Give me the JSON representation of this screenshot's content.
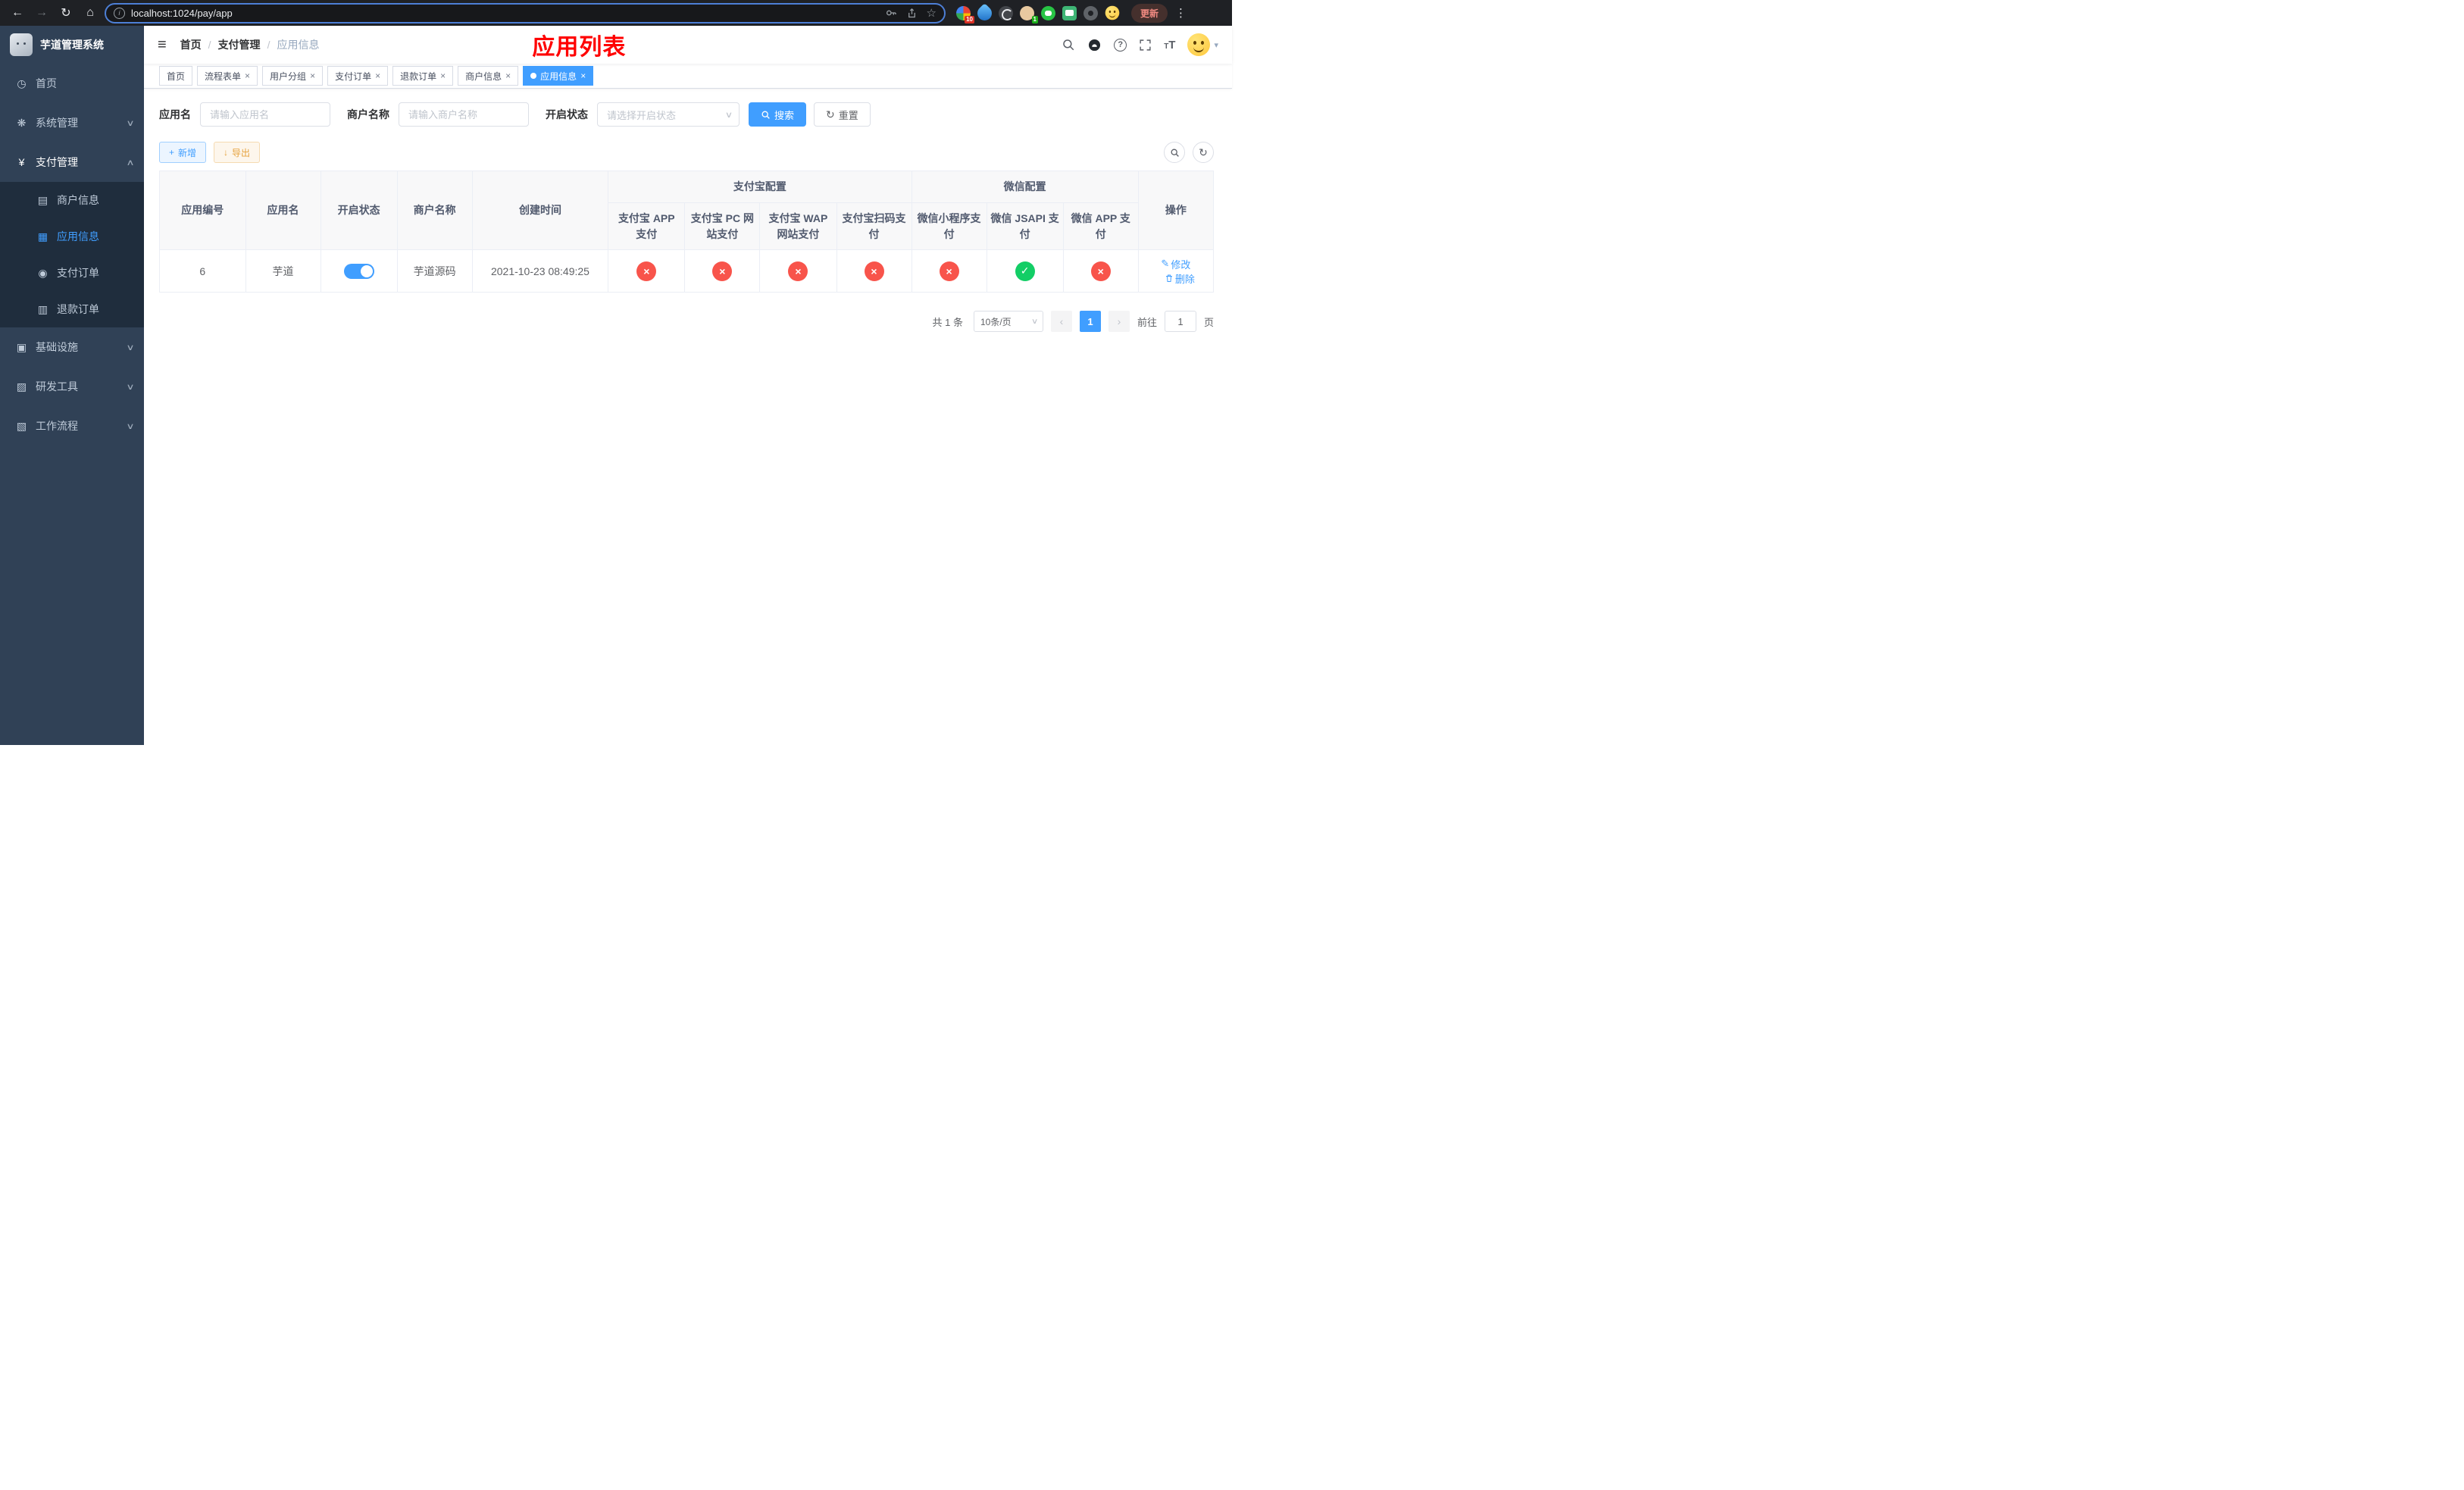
{
  "browser": {
    "url": "localhost:1024/pay/app",
    "update_label": "更新",
    "ext_badge_count": "10",
    "ext_badge_count2": "1"
  },
  "sidebar": {
    "logo_title": "芋道管理系统",
    "items": {
      "home": "首页",
      "system": "系统管理",
      "payment": "支付管理",
      "merchant_info": "商户信息",
      "app_info": "应用信息",
      "pay_order": "支付订单",
      "refund_order": "退款订单",
      "infrastructure": "基础设施",
      "dev_tools": "研发工具",
      "workflow": "工作流程"
    }
  },
  "header": {
    "breadcrumb_home": "首页",
    "breadcrumb_section": "支付管理",
    "breadcrumb_current": "应用信息",
    "page_title": "应用列表"
  },
  "tabs": [
    {
      "label": "首页"
    },
    {
      "label": "流程表单"
    },
    {
      "label": "用户分组"
    },
    {
      "label": "支付订单"
    },
    {
      "label": "退款订单"
    },
    {
      "label": "商户信息"
    },
    {
      "label": "应用信息"
    }
  ],
  "filters": {
    "app_name_label": "应用名",
    "app_name_placeholder": "请输入应用名",
    "merchant_label": "商户名称",
    "merchant_placeholder": "请输入商户名称",
    "status_label": "开启状态",
    "status_placeholder": "请选择开启状态",
    "search_label": "搜索",
    "reset_label": "重置"
  },
  "toolbar": {
    "add_label": "新增",
    "export_label": "导出"
  },
  "table": {
    "col_app_id": "应用编号",
    "col_app_name": "应用名",
    "col_status": "开启状态",
    "col_merchant": "商户名称",
    "col_created": "创建时间",
    "group_alipay": "支付宝配置",
    "group_wechat": "微信配置",
    "col_alipay_app": "支付宝 APP 支付",
    "col_alipay_pc": "支付宝 PC 网站支付",
    "col_alipay_wap": "支付宝 WAP 网站支付",
    "col_alipay_qr": "支付宝扫码支付",
    "col_wx_lite": "微信小程序支付",
    "col_wx_jsapi": "微信 JSAPI 支付",
    "col_wx_app": "微信 APP 支付",
    "col_actions": "操作",
    "rows": [
      {
        "id": "6",
        "name": "芋道",
        "status": "on",
        "merchant": "芋道源码",
        "created": "2021-10-23 08:49:25",
        "alipay_app": "no",
        "alipay_pc": "no",
        "alipay_wap": "no",
        "alipay_qr": "no",
        "wx_lite": "no",
        "wx_jsapi": "yes",
        "wx_app": "no",
        "edit_label": "修改",
        "delete_label": "删除"
      }
    ]
  },
  "pagination": {
    "total": "共 1 条",
    "page_size": "10条/页",
    "current_page": "1",
    "goto_label": "前往",
    "goto_value": "1",
    "page_label": "页"
  },
  "colors": {
    "primary": "#409eff",
    "danger": "#f8544b",
    "success": "#13ce66",
    "title_red": "#ff0000",
    "sidebar_bg": "#304156",
    "submenu_bg": "#1f2d3d"
  }
}
